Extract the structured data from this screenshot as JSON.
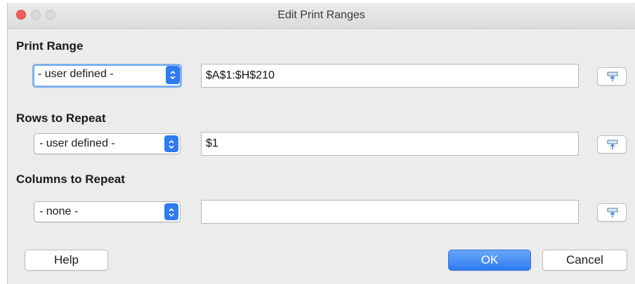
{
  "window": {
    "title": "Edit Print Ranges"
  },
  "sections": [
    {
      "label": "Print Range",
      "select_value": "- user defined -",
      "field_value": "$A$1:$H$210"
    },
    {
      "label": "Rows to Repeat",
      "select_value": "- user defined -",
      "field_value": "$1"
    },
    {
      "label": "Columns to Repeat",
      "select_value": "- none -",
      "field_value": ""
    }
  ],
  "buttons": {
    "help": "Help",
    "ok": "OK",
    "cancel": "Cancel"
  },
  "colors": {
    "accent": "#2f7cf2",
    "focus_ring": "#7fb0ee",
    "close": "#ee5f58"
  },
  "icons": {
    "shrink": "shrink-dialog-icon",
    "spinner": "up-down-chevrons-icon"
  }
}
